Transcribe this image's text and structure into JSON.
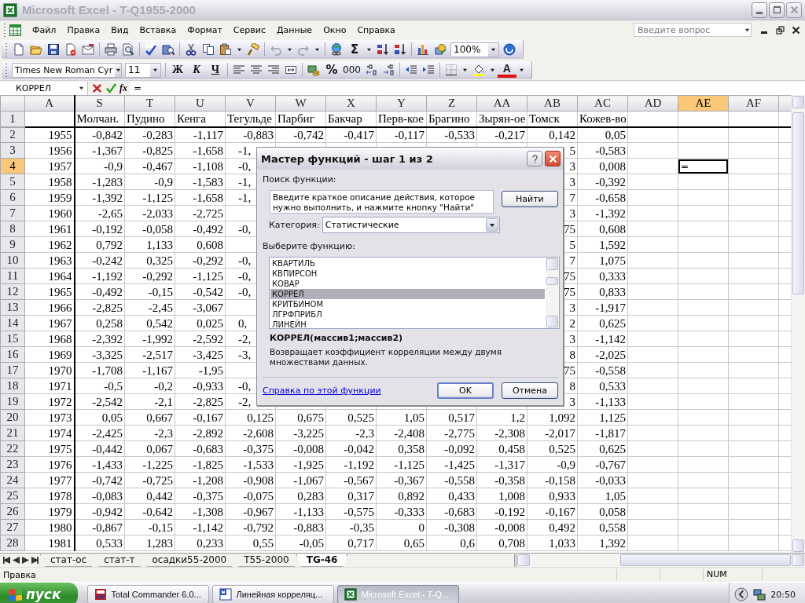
{
  "window": {
    "title": "Microsoft Excel - T-Q1955-2000",
    "active": false
  },
  "menu": [
    {
      "label": "Файл"
    },
    {
      "label": "Правка"
    },
    {
      "label": "Вид"
    },
    {
      "label": "Вставка"
    },
    {
      "label": "Формат"
    },
    {
      "label": "Сервис"
    },
    {
      "label": "Данные"
    },
    {
      "label": "Окно"
    },
    {
      "label": "Справка"
    }
  ],
  "help_search": {
    "placeholder": "Введите вопрос"
  },
  "standard_toolbar": {
    "sum": "Σ",
    "zoom": "100%"
  },
  "formatting_toolbar": {
    "font": "Times New Roman Cyr",
    "size": "11",
    "bold": "Ж",
    "italic": "К",
    "underline": "Ч",
    "percent": "%",
    "thousands": "000",
    "font_color": "A"
  },
  "formula_bar": {
    "name_box": "КОРРЕЛ",
    "fx": "fx",
    "value": "="
  },
  "sheet": {
    "columns": [
      {
        "label": "A",
        "selected": false
      },
      {
        "label": "S",
        "selected": false
      },
      {
        "label": "T",
        "selected": false
      },
      {
        "label": "U",
        "selected": false
      },
      {
        "label": "V",
        "selected": false
      },
      {
        "label": "W",
        "selected": false
      },
      {
        "label": "X",
        "selected": false
      },
      {
        "label": "Y",
        "selected": false
      },
      {
        "label": "Z",
        "selected": false
      },
      {
        "label": "AA",
        "selected": false
      },
      {
        "label": "AB",
        "selected": false
      },
      {
        "label": "AC",
        "selected": false
      },
      {
        "label": "AD",
        "selected": false
      },
      {
        "label": "AE",
        "selected": true
      },
      {
        "label": "AF",
        "selected": false
      }
    ],
    "rows": [
      {
        "label": "1",
        "selected": false,
        "kind": "header",
        "cells": [
          null,
          "Молчан.",
          "Пудино",
          "Кенга",
          "Тегульде",
          "Парбиг",
          "Бакчар",
          "Перв-кое",
          "Брагино",
          "Зырян-ое",
          "Томск",
          "Кожев-во"
        ]
      },
      {
        "label": "2",
        "selected": false,
        "kind": "data",
        "cells": [
          "1955",
          "-0,842",
          "-0,283",
          "-1,117",
          "-0,883",
          "-0,742",
          "-0,417",
          "-0,117",
          "-0,533",
          "-0,217",
          "0,142",
          "0,05"
        ]
      },
      {
        "label": "3",
        "selected": false,
        "kind": "data",
        "cells": [
          "1956",
          "-1,367",
          "-0,825",
          "-1,658",
          {
            "text": "-1,",
            "clipped": true
          },
          null,
          null,
          null,
          null,
          null,
          "5",
          "-0,583"
        ]
      },
      {
        "label": "4",
        "selected": true,
        "kind": "data",
        "cells": [
          "1957",
          "-0,9",
          "-0,467",
          "-1,108",
          {
            "text": "-0,",
            "clipped": true
          },
          null,
          null,
          null,
          null,
          null,
          "3",
          "0,008",
          null,
          {
            "text": "=",
            "selected": true
          }
        ]
      },
      {
        "label": "5",
        "selected": false,
        "kind": "data",
        "cells": [
          "1958",
          "-1,283",
          "-0,9",
          "-1,583",
          {
            "text": "-1,",
            "clipped": true
          },
          null,
          null,
          null,
          null,
          null,
          "3",
          "-0,392"
        ]
      },
      {
        "label": "6",
        "selected": false,
        "kind": "data",
        "cells": [
          "1959",
          "-1,392",
          "-1,125",
          "-1,658",
          {
            "text": "-1,",
            "clipped": true
          },
          null,
          null,
          null,
          null,
          null,
          "7",
          "-0,658"
        ]
      },
      {
        "label": "7",
        "selected": false,
        "kind": "data",
        "cells": [
          "1960",
          "-2,65",
          "-2,033",
          "-2,725",
          null,
          null,
          null,
          null,
          null,
          null,
          "3",
          "-1,392"
        ]
      },
      {
        "label": "8",
        "selected": false,
        "kind": "data",
        "cells": [
          "1961",
          "-0,192",
          "-0,058",
          "-0,492",
          {
            "text": "-0,",
            "clipped": true
          },
          null,
          null,
          null,
          null,
          null,
          "75",
          "0,608"
        ]
      },
      {
        "label": "9",
        "selected": false,
        "kind": "data",
        "cells": [
          "1962",
          "0,792",
          "1,133",
          "0,608",
          null,
          null,
          null,
          null,
          null,
          null,
          "5",
          "1,592"
        ]
      },
      {
        "label": "10",
        "selected": false,
        "kind": "data",
        "cells": [
          "1963",
          "-0,242",
          "0,325",
          "-0,292",
          {
            "text": "-0,",
            "clipped": true
          },
          null,
          null,
          null,
          null,
          null,
          "7",
          "1,075"
        ]
      },
      {
        "label": "11",
        "selected": false,
        "kind": "data",
        "cells": [
          "1964",
          "-1,192",
          "-0,292",
          "-1,125",
          {
            "text": "-0,",
            "clipped": true
          },
          null,
          null,
          null,
          null,
          null,
          "75",
          "0,333"
        ]
      },
      {
        "label": "12",
        "selected": false,
        "kind": "data",
        "cells": [
          "1965",
          "-0,492",
          "-0,15",
          "-0,542",
          {
            "text": "-0,",
            "clipped": true
          },
          null,
          null,
          null,
          null,
          null,
          "75",
          "0,833"
        ]
      },
      {
        "label": "13",
        "selected": false,
        "kind": "data",
        "cells": [
          "1966",
          "-2,825",
          "-2,45",
          "-3,067",
          null,
          null,
          null,
          null,
          null,
          null,
          "3",
          "-1,917"
        ]
      },
      {
        "label": "14",
        "selected": false,
        "kind": "data",
        "cells": [
          "1967",
          "0,258",
          "0,542",
          "0,025",
          {
            "text": "0,",
            "clipped": true
          },
          null,
          null,
          null,
          null,
          null,
          "2",
          "0,625"
        ]
      },
      {
        "label": "15",
        "selected": false,
        "kind": "data",
        "cells": [
          "1968",
          "-2,392",
          "-1,992",
          "-2,592",
          {
            "text": "-2,",
            "clipped": true
          },
          null,
          null,
          null,
          null,
          null,
          "3",
          "-1,142"
        ]
      },
      {
        "label": "16",
        "selected": false,
        "kind": "data",
        "cells": [
          "1969",
          "-3,325",
          "-2,517",
          "-3,425",
          {
            "text": "-3,",
            "clipped": true
          },
          null,
          null,
          null,
          null,
          null,
          "8",
          "-2,025"
        ]
      },
      {
        "label": "17",
        "selected": false,
        "kind": "data",
        "cells": [
          "1970",
          "-1,708",
          "-1,167",
          "-1,95",
          null,
          null,
          null,
          null,
          null,
          null,
          "75",
          "-0,558"
        ]
      },
      {
        "label": "18",
        "selected": false,
        "kind": "data",
        "cells": [
          "1971",
          "-0,5",
          "-0,2",
          "-0,933",
          {
            "text": "-0,",
            "clipped": true
          },
          null,
          null,
          null,
          null,
          null,
          "8",
          "0,533"
        ]
      },
      {
        "label": "19",
        "selected": false,
        "kind": "data",
        "cells": [
          "1972",
          "-2,542",
          "-2,1",
          "-2,825",
          {
            "text": "-2,",
            "clipped": true
          },
          null,
          null,
          null,
          null,
          null,
          "3",
          "-1,133"
        ]
      },
      {
        "label": "20",
        "selected": false,
        "kind": "data",
        "cells": [
          "1973",
          "0,05",
          "0,667",
          "-0,167",
          "0,125",
          "0,675",
          "0,525",
          "1,05",
          "0,517",
          "1,2",
          "1,092",
          "1,125"
        ]
      },
      {
        "label": "21",
        "selected": false,
        "kind": "data",
        "cells": [
          "1974",
          "-2,425",
          "-2,3",
          "-2,892",
          "-2,608",
          "-3,225",
          "-2,3",
          "-2,408",
          "-2,775",
          "-2,308",
          "-2,017",
          "-1,817"
        ]
      },
      {
        "label": "22",
        "selected": false,
        "kind": "data",
        "cells": [
          "1975",
          "-0,442",
          "0,067",
          "-0,683",
          "-0,375",
          "-0,008",
          "-0,042",
          "0,358",
          "-0,092",
          "0,458",
          "0,525",
          "0,625"
        ]
      },
      {
        "label": "23",
        "selected": false,
        "kind": "data",
        "cells": [
          "1976",
          "-1,433",
          "-1,225",
          "-1,825",
          "-1,533",
          "-1,925",
          "-1,192",
          "-1,125",
          "-1,425",
          "-1,317",
          "-0,9",
          "-0,767"
        ]
      },
      {
        "label": "24",
        "selected": false,
        "kind": "data",
        "cells": [
          "1977",
          "-0,742",
          "-0,725",
          "-1,208",
          "-0,908",
          "-1,067",
          "-0,567",
          "-0,367",
          "-0,558",
          "-0,358",
          "-0,158",
          "-0,033"
        ]
      },
      {
        "label": "25",
        "selected": false,
        "kind": "data",
        "cells": [
          "1978",
          "-0,083",
          "0,442",
          "-0,375",
          "-0,075",
          "0,283",
          "0,317",
          "0,892",
          "0,433",
          "1,008",
          "0,933",
          "1,05"
        ]
      },
      {
        "label": "26",
        "selected": false,
        "kind": "data",
        "cells": [
          "1979",
          "-0,942",
          "-0,642",
          "-1,308",
          "-0,967",
          "-1,133",
          "-0,575",
          "-0,333",
          "-0,683",
          "-0,192",
          "-0,167",
          "0,058"
        ]
      },
      {
        "label": "27",
        "selected": false,
        "kind": "data",
        "cells": [
          "1980",
          "-0,867",
          "-0,15",
          "-1,142",
          "-0,792",
          "-0,883",
          "-0,35",
          "0",
          "-0,308",
          "-0,008",
          "0,492",
          "0,558"
        ]
      },
      {
        "label": "28",
        "selected": false,
        "kind": "data",
        "cells": [
          "1981",
          "0,533",
          "1,283",
          "0,233",
          "0,55",
          "-0,05",
          "0,717",
          "0,65",
          "0,6",
          "0,708",
          "1,033",
          "1,392"
        ]
      }
    ]
  },
  "sheet_tabs": [
    {
      "label": "стат-ос",
      "selected": false
    },
    {
      "label": "стат-т",
      "selected": false
    },
    {
      "label": "осадки55-2000",
      "selected": false
    },
    {
      "label": "T55-2000",
      "selected": false
    },
    {
      "label": "TG-46",
      "selected": true
    }
  ],
  "status_bar": {
    "mode": "Правка",
    "indicator": "NUM"
  },
  "taskbar": {
    "start": "пуск",
    "tasks": [
      {
        "label": "Total Commander 6.0...",
        "kind": "commander",
        "selected": false
      },
      {
        "label": "Линейная корреляц...",
        "kind": "word",
        "selected": false
      },
      {
        "label": "Microsoft Excel - T-Q...",
        "kind": "excel",
        "selected": true
      }
    ],
    "clock": "20:50"
  },
  "dialog": {
    "title": "Мастер функций - шаг 1 из 2",
    "search_label": "Поиск функции:",
    "search_value": "Введите краткое описание действия, которое нужно выполнить, и нажмите кнопку \"Найти\"",
    "find_button": "Найти",
    "category_label": "Категория:",
    "category": "Статистические",
    "list_label": "Выберите функцию:",
    "functions": [
      {
        "name": "КВАРТИЛЬ",
        "selected": false
      },
      {
        "name": "КВПИРСОН",
        "selected": false
      },
      {
        "name": "КОВАР",
        "selected": false
      },
      {
        "name": "КОРРЕЛ",
        "selected": true
      },
      {
        "name": "КРИТБИНОМ",
        "selected": false
      },
      {
        "name": "ЛГРФПРИБЛ",
        "selected": false
      },
      {
        "name": "ЛИНЕЙН",
        "selected": false
      }
    ],
    "signature": "КОРРЕЛ(массив1;массив2)",
    "description": "Возвращает коэффициент корреляции между двумя множествами данных.",
    "help_link": "Справка по этой функции",
    "ok_button": "OK",
    "cancel_button": "Отмена"
  }
}
